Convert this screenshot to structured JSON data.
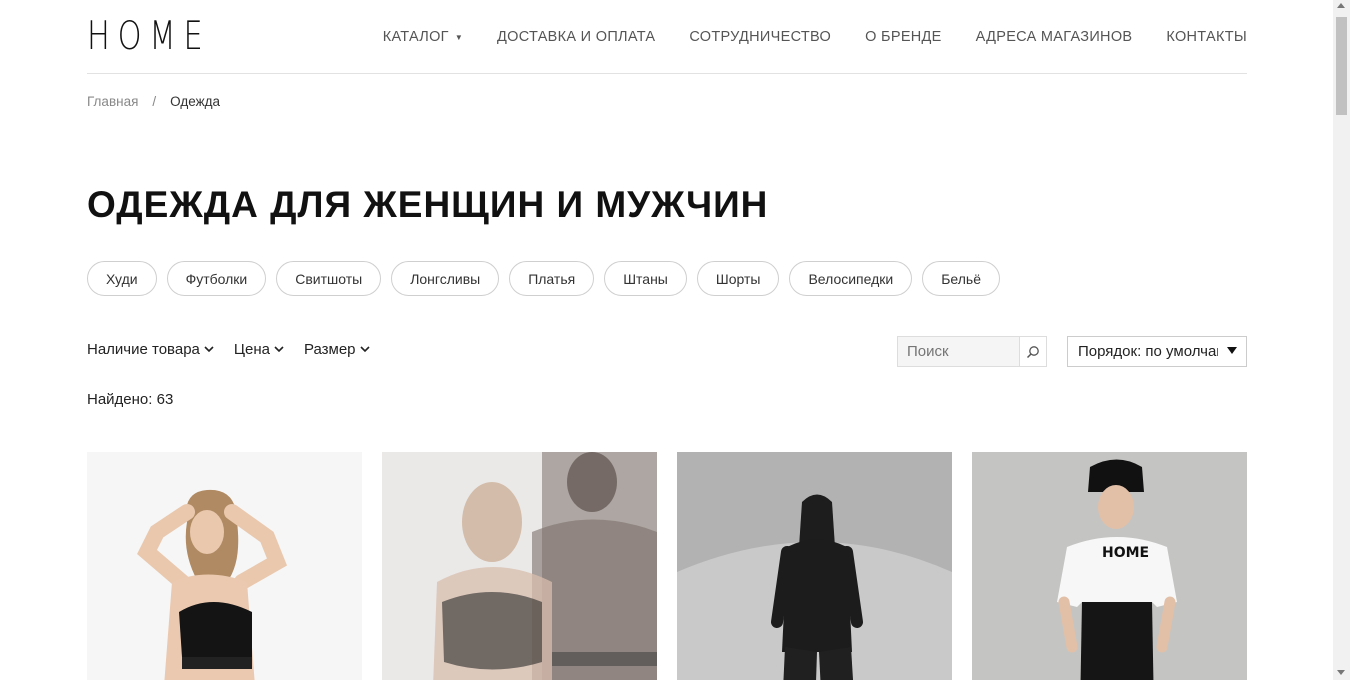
{
  "header": {
    "logo": "HOME",
    "nav": [
      {
        "label": "КАТАЛОГ",
        "has_dropdown": true
      },
      {
        "label": "ДОСТАВКА И ОПЛАТА"
      },
      {
        "label": "СОТРУДНИЧЕСТВО"
      },
      {
        "label": "О БРЕНДЕ"
      },
      {
        "label": "АДРЕСА МАГАЗИНОВ"
      },
      {
        "label": "КОНТАКТЫ"
      }
    ]
  },
  "breadcrumb": {
    "home": "Главная",
    "separator": "/",
    "current": "Одежда"
  },
  "page_title": "ОДЕЖДА ДЛЯ ЖЕНЩИН И МУЖЧИН",
  "categories": [
    "Худи",
    "Футболки",
    "Свитшоты",
    "Лонгсливы",
    "Платья",
    "Штаны",
    "Шорты",
    "Велосипедки",
    "Бельё"
  ],
  "filters": {
    "availability": "Наличие товара",
    "price": "Цена",
    "size": "Размер"
  },
  "search": {
    "placeholder": "Поиск"
  },
  "sort": {
    "value": "Порядок: по умолчанию"
  },
  "found": "Найдено: 63",
  "colors": {
    "accent": "#111111",
    "muted": "#888888",
    "chip_border": "#cfcfcf"
  },
  "products": [
    {
      "image": "model-black-sports-bra"
    },
    {
      "image": "models-sports-bra-overlay"
    },
    {
      "image": "model-black-tracksuit"
    },
    {
      "image": "model-white-tshirt-black-pants"
    }
  ]
}
